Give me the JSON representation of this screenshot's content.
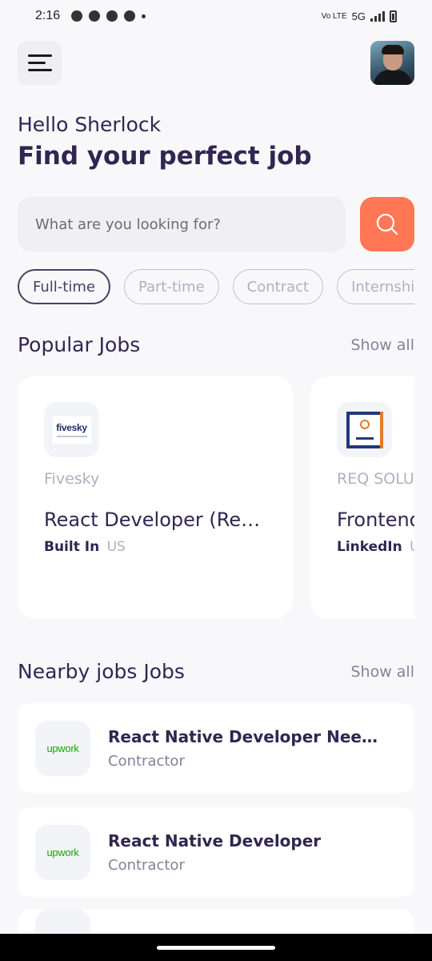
{
  "status_bar": {
    "time": "2:16",
    "network": "5G",
    "volte": "Vo LTE"
  },
  "header": {
    "greeting": "Hello Sherlock",
    "headline": "Find your perfect job"
  },
  "search": {
    "placeholder": "What are you looking for?",
    "button_color": "#ff7754"
  },
  "job_types": {
    "active": "Full-time",
    "items": [
      "Full-time",
      "Part-time",
      "Contract",
      "Internship"
    ]
  },
  "popular": {
    "title": "Popular Jobs",
    "show_all": "Show all",
    "cards": [
      {
        "company": "Fivesky",
        "logo_text": "fivesky",
        "title": "React Developer (Remote)",
        "publisher": "Built In",
        "country": "US"
      },
      {
        "company": "REQ SOLUTIONS",
        "logo_text": "REQ SOLUTIONS",
        "title": "Frontend Developer",
        "publisher": "LinkedIn",
        "country": "US"
      }
    ]
  },
  "nearby": {
    "title": "Nearby jobs Jobs",
    "show_all": "Show all",
    "jobs": [
      {
        "logo_text": "upwork",
        "title": "React Native Developer Needed",
        "type": "Contractor"
      },
      {
        "logo_text": "upwork",
        "title": "React Native Developer",
        "type": "Contractor"
      }
    ]
  }
}
